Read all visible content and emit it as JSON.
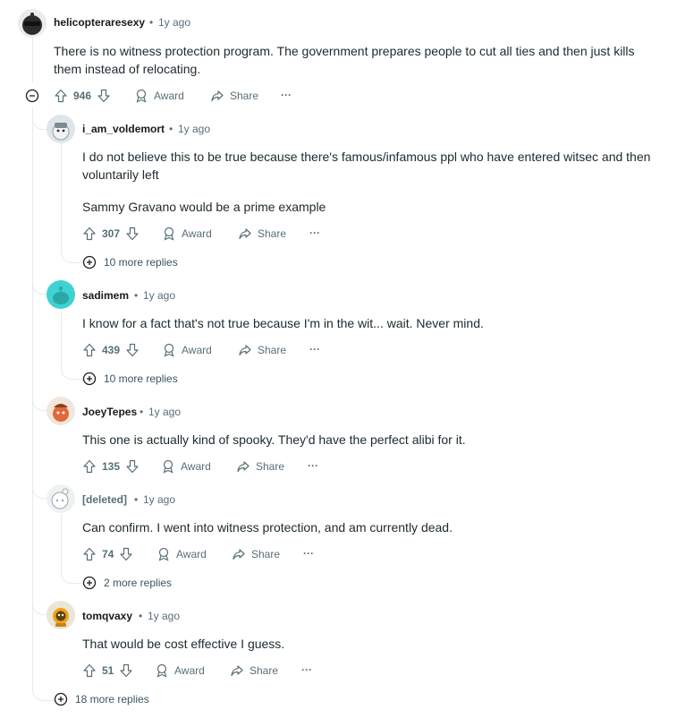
{
  "top": {
    "username": "helicopteraresexy",
    "dot": "•",
    "time": "1y ago",
    "body": "There is no witness protection program. The government prepares people to cut all ties and then just kills them instead of relocating.",
    "votes": "946",
    "award": "Award",
    "share": "Share",
    "more_replies": "18 more replies"
  },
  "replies": [
    {
      "username": "i_am_voldemort",
      "time": "1y ago",
      "body1": "I do not believe this to be true because there's famous/infamous ppl who have entered witsec and then voluntarily left",
      "body2": "Sammy Gravano would be a prime example",
      "votes": "307",
      "more_replies": "10 more replies"
    },
    {
      "username": "sadimem",
      "time": "1y ago",
      "body1": "I know for a fact that's not true because I'm in the wit... wait. Never mind.",
      "votes": "439",
      "more_replies": "10 more replies"
    },
    {
      "username": "JoeyTepes",
      "time": "1y ago",
      "body1": "This one is actually kind of spooky. They'd have the perfect alibi for it.",
      "votes": "135"
    },
    {
      "username": "[deleted]",
      "time": "1y ago",
      "body1": "Can confirm. I went into witness protection, and am currently dead.",
      "votes": "74",
      "more_replies": "2 more replies"
    },
    {
      "username": "tomqvaxy",
      "time": "1y ago",
      "body1": "That would be cost effective I guess.",
      "votes": "51"
    }
  ],
  "labels": {
    "award": "Award",
    "share": "Share",
    "dot": "•",
    "overflow": "···"
  },
  "colors": {
    "thread_line": "#e5ebee",
    "meta_text": "#576f76",
    "body_text": "#1c2a30"
  }
}
